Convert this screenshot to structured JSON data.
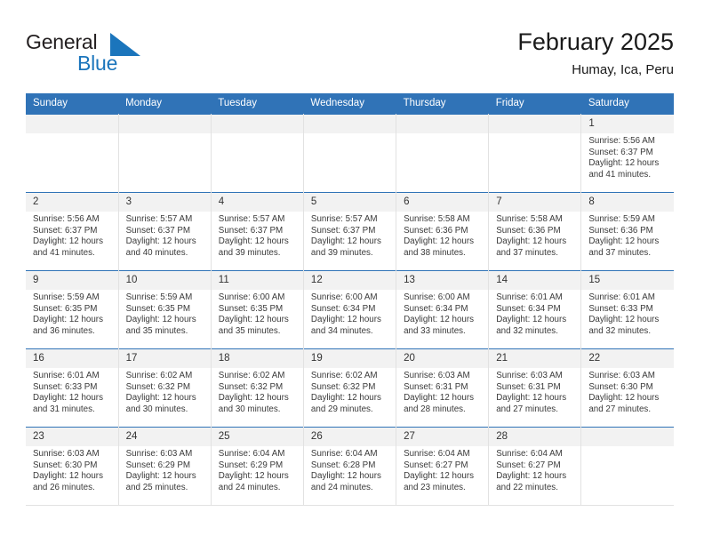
{
  "brand": {
    "name_part1": "General",
    "name_part2": "Blue",
    "logo_icon": "triangle-flag-icon",
    "colors": {
      "blue": "#1b75bc",
      "dark": "#231f20"
    }
  },
  "header": {
    "title": "February 2025",
    "location": "Humay, Ica, Peru"
  },
  "colors": {
    "header_band": "#3073b7",
    "daynum_band": "#f2f2f2",
    "cell_border": "#e2e2e2"
  },
  "weekdays": [
    "Sunday",
    "Monday",
    "Tuesday",
    "Wednesday",
    "Thursday",
    "Friday",
    "Saturday"
  ],
  "labels": {
    "sunrise_prefix": "Sunrise:",
    "sunset_prefix": "Sunset:",
    "daylight_prefix": "Daylight:"
  },
  "weeks": [
    [
      {
        "blank": true,
        "day": ""
      },
      {
        "blank": true,
        "day": ""
      },
      {
        "blank": true,
        "day": ""
      },
      {
        "blank": true,
        "day": ""
      },
      {
        "blank": true,
        "day": ""
      },
      {
        "blank": true,
        "day": ""
      },
      {
        "blank": false,
        "day": "1",
        "sunrise": "Sunrise: 5:56 AM",
        "sunset": "Sunset: 6:37 PM",
        "daylight": "Daylight: 12 hours and 41 minutes."
      }
    ],
    [
      {
        "blank": false,
        "day": "2",
        "sunrise": "Sunrise: 5:56 AM",
        "sunset": "Sunset: 6:37 PM",
        "daylight": "Daylight: 12 hours and 41 minutes."
      },
      {
        "blank": false,
        "day": "3",
        "sunrise": "Sunrise: 5:57 AM",
        "sunset": "Sunset: 6:37 PM",
        "daylight": "Daylight: 12 hours and 40 minutes."
      },
      {
        "blank": false,
        "day": "4",
        "sunrise": "Sunrise: 5:57 AM",
        "sunset": "Sunset: 6:37 PM",
        "daylight": "Daylight: 12 hours and 39 minutes."
      },
      {
        "blank": false,
        "day": "5",
        "sunrise": "Sunrise: 5:57 AM",
        "sunset": "Sunset: 6:37 PM",
        "daylight": "Daylight: 12 hours and 39 minutes."
      },
      {
        "blank": false,
        "day": "6",
        "sunrise": "Sunrise: 5:58 AM",
        "sunset": "Sunset: 6:36 PM",
        "daylight": "Daylight: 12 hours and 38 minutes."
      },
      {
        "blank": false,
        "day": "7",
        "sunrise": "Sunrise: 5:58 AM",
        "sunset": "Sunset: 6:36 PM",
        "daylight": "Daylight: 12 hours and 37 minutes."
      },
      {
        "blank": false,
        "day": "8",
        "sunrise": "Sunrise: 5:59 AM",
        "sunset": "Sunset: 6:36 PM",
        "daylight": "Daylight: 12 hours and 37 minutes."
      }
    ],
    [
      {
        "blank": false,
        "day": "9",
        "sunrise": "Sunrise: 5:59 AM",
        "sunset": "Sunset: 6:35 PM",
        "daylight": "Daylight: 12 hours and 36 minutes."
      },
      {
        "blank": false,
        "day": "10",
        "sunrise": "Sunrise: 5:59 AM",
        "sunset": "Sunset: 6:35 PM",
        "daylight": "Daylight: 12 hours and 35 minutes."
      },
      {
        "blank": false,
        "day": "11",
        "sunrise": "Sunrise: 6:00 AM",
        "sunset": "Sunset: 6:35 PM",
        "daylight": "Daylight: 12 hours and 35 minutes."
      },
      {
        "blank": false,
        "day": "12",
        "sunrise": "Sunrise: 6:00 AM",
        "sunset": "Sunset: 6:34 PM",
        "daylight": "Daylight: 12 hours and 34 minutes."
      },
      {
        "blank": false,
        "day": "13",
        "sunrise": "Sunrise: 6:00 AM",
        "sunset": "Sunset: 6:34 PM",
        "daylight": "Daylight: 12 hours and 33 minutes."
      },
      {
        "blank": false,
        "day": "14",
        "sunrise": "Sunrise: 6:01 AM",
        "sunset": "Sunset: 6:34 PM",
        "daylight": "Daylight: 12 hours and 32 minutes."
      },
      {
        "blank": false,
        "day": "15",
        "sunrise": "Sunrise: 6:01 AM",
        "sunset": "Sunset: 6:33 PM",
        "daylight": "Daylight: 12 hours and 32 minutes."
      }
    ],
    [
      {
        "blank": false,
        "day": "16",
        "sunrise": "Sunrise: 6:01 AM",
        "sunset": "Sunset: 6:33 PM",
        "daylight": "Daylight: 12 hours and 31 minutes."
      },
      {
        "blank": false,
        "day": "17",
        "sunrise": "Sunrise: 6:02 AM",
        "sunset": "Sunset: 6:32 PM",
        "daylight": "Daylight: 12 hours and 30 minutes."
      },
      {
        "blank": false,
        "day": "18",
        "sunrise": "Sunrise: 6:02 AM",
        "sunset": "Sunset: 6:32 PM",
        "daylight": "Daylight: 12 hours and 30 minutes."
      },
      {
        "blank": false,
        "day": "19",
        "sunrise": "Sunrise: 6:02 AM",
        "sunset": "Sunset: 6:32 PM",
        "daylight": "Daylight: 12 hours and 29 minutes."
      },
      {
        "blank": false,
        "day": "20",
        "sunrise": "Sunrise: 6:03 AM",
        "sunset": "Sunset: 6:31 PM",
        "daylight": "Daylight: 12 hours and 28 minutes."
      },
      {
        "blank": false,
        "day": "21",
        "sunrise": "Sunrise: 6:03 AM",
        "sunset": "Sunset: 6:31 PM",
        "daylight": "Daylight: 12 hours and 27 minutes."
      },
      {
        "blank": false,
        "day": "22",
        "sunrise": "Sunrise: 6:03 AM",
        "sunset": "Sunset: 6:30 PM",
        "daylight": "Daylight: 12 hours and 27 minutes."
      }
    ],
    [
      {
        "blank": false,
        "day": "23",
        "sunrise": "Sunrise: 6:03 AM",
        "sunset": "Sunset: 6:30 PM",
        "daylight": "Daylight: 12 hours and 26 minutes."
      },
      {
        "blank": false,
        "day": "24",
        "sunrise": "Sunrise: 6:03 AM",
        "sunset": "Sunset: 6:29 PM",
        "daylight": "Daylight: 12 hours and 25 minutes."
      },
      {
        "blank": false,
        "day": "25",
        "sunrise": "Sunrise: 6:04 AM",
        "sunset": "Sunset: 6:29 PM",
        "daylight": "Daylight: 12 hours and 24 minutes."
      },
      {
        "blank": false,
        "day": "26",
        "sunrise": "Sunrise: 6:04 AM",
        "sunset": "Sunset: 6:28 PM",
        "daylight": "Daylight: 12 hours and 24 minutes."
      },
      {
        "blank": false,
        "day": "27",
        "sunrise": "Sunrise: 6:04 AM",
        "sunset": "Sunset: 6:27 PM",
        "daylight": "Daylight: 12 hours and 23 minutes."
      },
      {
        "blank": false,
        "day": "28",
        "sunrise": "Sunrise: 6:04 AM",
        "sunset": "Sunset: 6:27 PM",
        "daylight": "Daylight: 12 hours and 22 minutes."
      },
      {
        "blank": true,
        "day": ""
      }
    ]
  ]
}
